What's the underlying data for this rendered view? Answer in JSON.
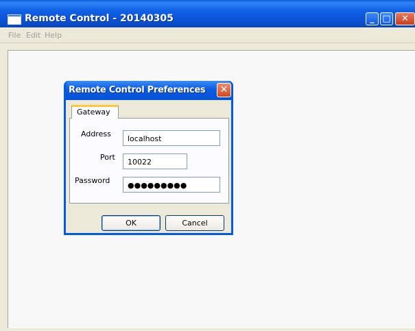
{
  "window": {
    "title": "Remote Control - 20140305",
    "buttons": {
      "minimize": "_",
      "maximize": "□",
      "close": "✕"
    }
  },
  "menu": {
    "items": [
      {
        "label": "File"
      },
      {
        "label": "Edit"
      },
      {
        "label": "Help"
      }
    ]
  },
  "dialog": {
    "title": "Remote Control Preferences",
    "close_glyph": "✕",
    "tabs": [
      {
        "label": "Gateway",
        "selected": true
      }
    ],
    "fields": {
      "address": {
        "label": "Address",
        "value": "localhost"
      },
      "port": {
        "label": "Port",
        "value": "10022"
      },
      "password": {
        "label": "Password",
        "value": "●●●●●●●●●"
      }
    },
    "buttons": {
      "ok": "OK",
      "cancel": "Cancel"
    }
  },
  "icons": {
    "app": "window-icon",
    "minimize": "minimize-icon",
    "maximize": "maximize-icon",
    "close": "close-icon"
  },
  "colors": {
    "titlebar": "#0a52d6",
    "close_button": "#d24a22",
    "tab_highlight": "#ffc83c",
    "window_bg": "#ece9d8"
  }
}
